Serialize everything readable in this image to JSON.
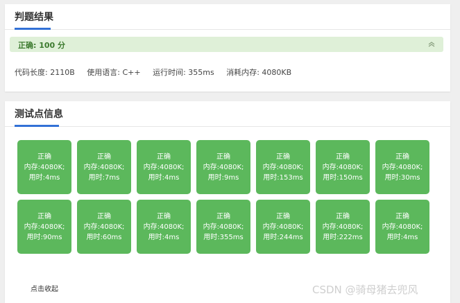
{
  "judge": {
    "title": "判题结果",
    "result": "正确:   100 分",
    "info": {
      "code_length": "代码长度: 2110B",
      "language": "使用语言: C++",
      "run_time": "运行时间: 355ms",
      "memory": "消耗内存: 4080KB"
    }
  },
  "tests": {
    "title": "测试点信息",
    "rows": [
      [
        {
          "status": "正确",
          "memory": "内存:4080K;",
          "time": "用时:4ms"
        },
        {
          "status": "正确",
          "memory": "内存:4080K;",
          "time": "用时:7ms"
        },
        {
          "status": "正确",
          "memory": "内存:4080K;",
          "time": "用时:4ms"
        },
        {
          "status": "正确",
          "memory": "内存:4080K;",
          "time": "用时:9ms"
        },
        {
          "status": "正确",
          "memory": "内存:4080K;",
          "time": "用时:153ms"
        },
        {
          "status": "正确",
          "memory": "内存:4080K;",
          "time": "用时:150ms"
        },
        {
          "status": "正确",
          "memory": "内存:4080K;",
          "time": "用时:30ms"
        }
      ],
      [
        {
          "status": "正确",
          "memory": "内存:4080K;",
          "time": "用时:90ms"
        },
        {
          "status": "正确",
          "memory": "内存:4080K;",
          "time": "用时:60ms"
        },
        {
          "status": "正确",
          "memory": "内存:4080K;",
          "time": "用时:4ms"
        },
        {
          "status": "正确",
          "memory": "内存:4080K;",
          "time": "用时:355ms"
        },
        {
          "status": "正确",
          "memory": "内存:4080K;",
          "time": "用时:244ms"
        },
        {
          "status": "正确",
          "memory": "内存:4080K;",
          "time": "用时:222ms"
        },
        {
          "status": "正确",
          "memory": "内存:4080K;",
          "time": "用时:4ms"
        }
      ]
    ],
    "collapse_label": "点击收起"
  },
  "watermark": "CSDN @骑母猪去兜风",
  "colors": {
    "accent": "#3271d6",
    "success_bg": "#dff0d8",
    "success_text": "#3c7a2e",
    "tile": "#5cb85c"
  },
  "icons": {
    "collapse": "double-chevron-up-icon"
  }
}
